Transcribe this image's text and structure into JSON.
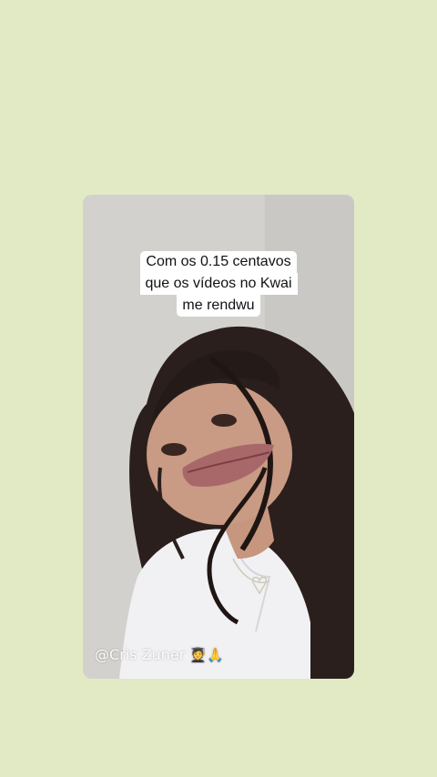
{
  "background_color": "#e2e9c5",
  "video": {
    "caption_lines": [
      "Com os 0.15 centavos",
      "que os vídeos no Kwai",
      "me rendwu"
    ],
    "watermark_handle": "@Cris Zuner",
    "watermark_emojis": "🧑‍🎓🙏"
  }
}
